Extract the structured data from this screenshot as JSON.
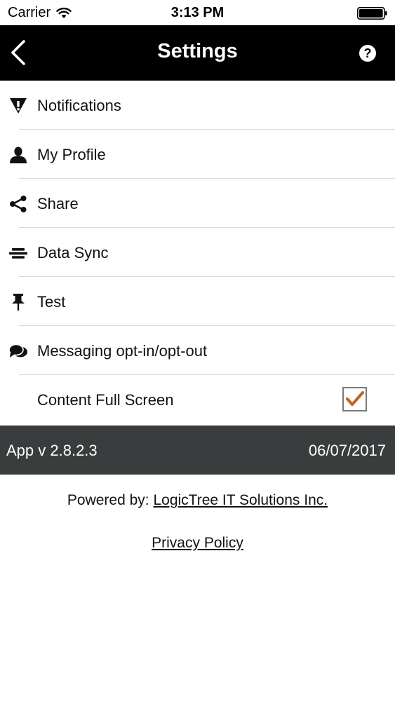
{
  "status_bar": {
    "carrier": "Carrier",
    "time": "3:13 PM"
  },
  "nav": {
    "title": "Settings",
    "help_label": "?"
  },
  "menu": {
    "items": [
      {
        "label": "Notifications",
        "icon": "warning-icon"
      },
      {
        "label": "My Profile",
        "icon": "user-icon"
      },
      {
        "label": "Share",
        "icon": "share-icon"
      },
      {
        "label": "Data Sync",
        "icon": "sync-icon"
      },
      {
        "label": "Test",
        "icon": "pin-icon"
      },
      {
        "label": "Messaging opt-in/opt-out",
        "icon": "chat-icon"
      },
      {
        "label": "Content Full Screen",
        "checked": true
      }
    ]
  },
  "version_bar": {
    "app_version": "App v 2.8.2.3",
    "date": "06/07/2017"
  },
  "footer": {
    "powered_prefix": "Powered by:",
    "company_link": "LogicTree IT Solutions Inc.",
    "privacy_link": "Privacy Policy"
  },
  "colors": {
    "nav_background": "#000000",
    "version_bar_background": "#3a3d3d",
    "checkmark": "#c0642a"
  }
}
